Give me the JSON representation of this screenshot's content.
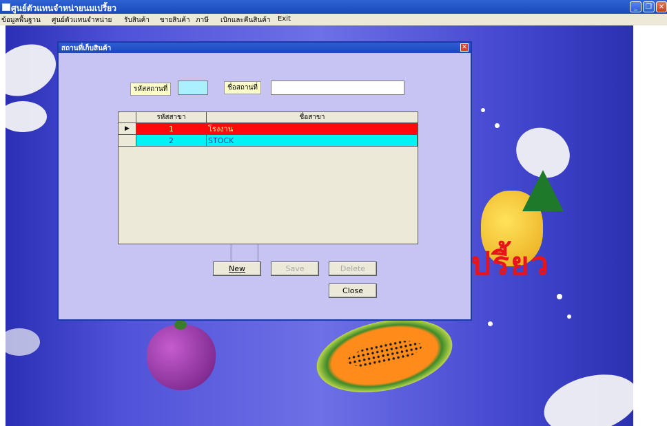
{
  "window": {
    "title": "ศูนย์ตัวแทนจำหน่ายนมเปรี้ยว",
    "min_icon": "minimize-icon",
    "restore_icon": "restore-icon",
    "close_icon": "close-icon"
  },
  "menu": {
    "items": [
      "ข้อมูลพื้นฐาน",
      "ศูนย์ตัวแทนจำหน่าย",
      "รับสินค้า",
      "ขายสินค้า",
      "ภาษี",
      "เบิกและคืนสินค้า",
      "Exit"
    ]
  },
  "background": {
    "brand_text": "ปรี้ยว"
  },
  "dialog": {
    "title": "สถานที่เก็บสินค้า",
    "fields": {
      "code_label": "รหัสสถานที่",
      "code_value": "",
      "name_label": "ชื่อสถานที่",
      "name_value": ""
    },
    "grid": {
      "headers": [
        "รหัสสาขา",
        "ชื่อสาขา"
      ],
      "current_row_marker": "▶",
      "rows": [
        {
          "code": "1",
          "name": "โรงงาน"
        },
        {
          "code": "2",
          "name": "STOCK"
        }
      ]
    },
    "buttons": {
      "new": "New",
      "save": "Save",
      "delete": "Delete",
      "close": "Close"
    }
  },
  "colors": {
    "dialog_bg": "#c7c4f4",
    "row1_bg": "#ff0a0a",
    "row2_bg": "#00f2f2",
    "titlebar": "#2f63d6"
  }
}
